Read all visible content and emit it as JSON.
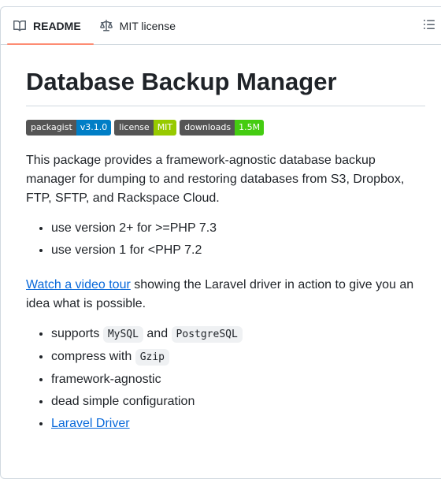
{
  "tabs": [
    {
      "label": "README",
      "icon": "book-icon",
      "active": true
    },
    {
      "label": "MIT license",
      "icon": "law-scale-icon",
      "active": false
    }
  ],
  "outline_icon": "list-unordered-icon",
  "title": "Database Backup Manager",
  "badges": [
    {
      "left": "packagist",
      "right": "v3.1.0",
      "color": "#007ec6"
    },
    {
      "left": "license",
      "right": "MIT",
      "color": "#97ca00"
    },
    {
      "left": "downloads",
      "right": "1.5M",
      "color": "#4c1"
    }
  ],
  "intro": "This package provides a framework-agnostic database backup manager for dumping to and restoring databases from S3, Dropbox, FTP, SFTP, and Rackspace Cloud.",
  "versions": [
    "use version 2+ for >=PHP 7.3",
    "use version 1 for <PHP 7.2"
  ],
  "video": {
    "link": "Watch a video tour",
    "text": " showing the Laravel driver in action to give you an idea what is possible."
  },
  "features": {
    "supports_prefix": "supports ",
    "supports_and": " and ",
    "mysql": "MySQL",
    "postgres": "PostgreSQL",
    "compress_prefix": "compress with ",
    "gzip": "Gzip",
    "agnostic": "framework-agnostic",
    "simple": "dead simple configuration",
    "laravel_driver": "Laravel Driver"
  }
}
